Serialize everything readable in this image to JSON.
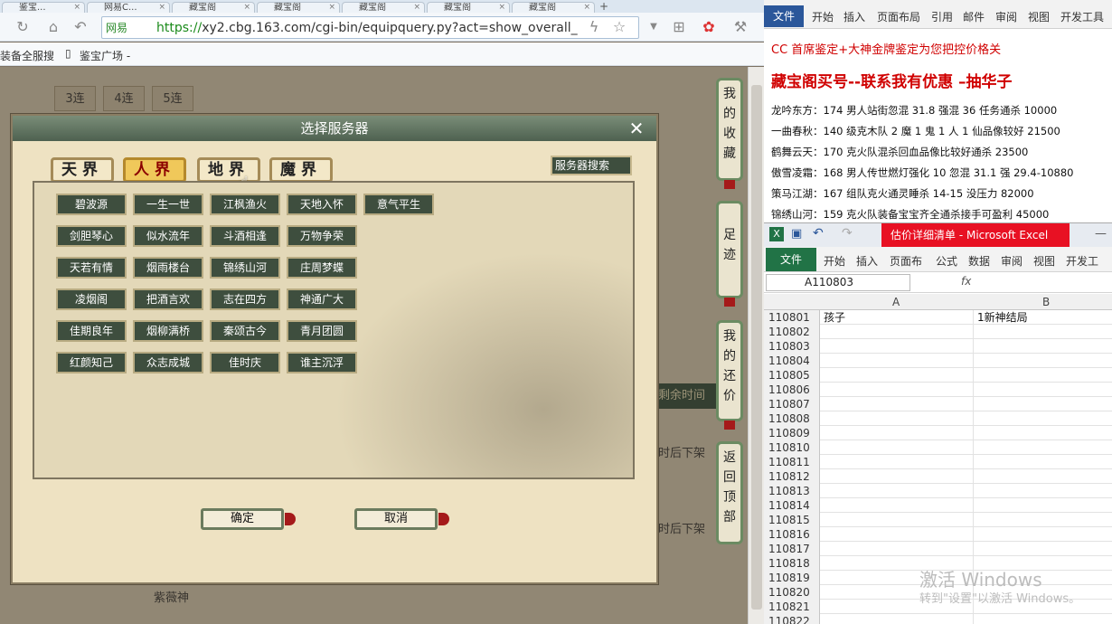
{
  "browser": {
    "tabs": [
      "鉴宝...",
      "网易C...",
      "藏宝阁",
      "藏宝阁",
      "藏宝阁",
      "藏宝阁",
      "藏宝阁"
    ],
    "new_tab": "+",
    "site_label": "网易",
    "url_secure": "https://",
    "url_rest": "xy2.cbg.163.com/cgi-bin/equipquery.py?act=show_overall_",
    "bookmarks": [
      "装备全服搜",
      "鉴宝广场 -"
    ]
  },
  "page": {
    "tabs": [
      "3连",
      "4连",
      "5连"
    ],
    "bg_texts": [
      "剩余时间",
      "时后下架",
      "时后下架",
      "紫薇神"
    ]
  },
  "side_buttons": [
    "我的收藏",
    "足迹",
    "我的还价",
    "返回顶部"
  ],
  "dialog": {
    "title": "选择服务器",
    "close": "✕",
    "realms": [
      "天界",
      "人界",
      "地界",
      "魔界"
    ],
    "active_realm": "人界",
    "search_button": "服务器搜索",
    "servers": [
      [
        "碧波源",
        "一生一世",
        "江枫渔火",
        "天地入怀",
        "意气平生"
      ],
      [
        "剑胆琴心",
        "似水流年",
        "斗酒相逢",
        "万物争荣"
      ],
      [
        "天若有情",
        "烟雨楼台",
        "锦绣山河",
        "庄周梦蝶"
      ],
      [
        "凌烟阁",
        "把酒言欢",
        "志在四方",
        "神通广大"
      ],
      [
        "佳期良年",
        "烟柳满桥",
        "秦颂古今",
        "青月团圆"
      ],
      [
        "红颜知己",
        "众志成城",
        "佳时庆",
        "谁主沉浮"
      ]
    ],
    "ok": "确定",
    "cancel": "取消"
  },
  "word": {
    "ribbon_file": "文件",
    "ribbon_tabs": [
      "开始",
      "插入",
      "页面布局",
      "引用",
      "邮件",
      "审阅",
      "视图",
      "开发工具"
    ],
    "line1": "CC 首席鉴定+大神金牌鉴定为您把控价格关",
    "line2": "藏宝阁买号--联系我有优惠 –抽华子",
    "entries": [
      "龙吟东方：174 男人站街忽混 31.8 强混 36 任务通杀 10000",
      "一曲春秋：140 级克木队 2 魔 1 鬼 1 人 1 仙品像较好 21500",
      "鹤舞云天：170 克火队混杀回血品像比较好通杀 23500",
      "傲雪凌霜：168 男人传世燃灯强化 10 忽混 31.1 强 29.4-10880",
      "策马江湖：167 组队克火通灵睡杀 14-15 没压力 82000",
      "锦绣山河：159 克火队装备宝宝齐全通杀接手可盈利 45000"
    ]
  },
  "excel": {
    "title": "估价详细清单 - Microsoft Excel",
    "ribbon_file": "文件",
    "ribbon_tabs": [
      "开始",
      "插入",
      "页面布",
      "公式",
      "数据",
      "审阅",
      "视图",
      "开发工"
    ],
    "namebox": "A110803",
    "fx": "fx",
    "col_a": "A",
    "col_b": "B",
    "rows": [
      {
        "n": "110801",
        "a": "孩子",
        "b": "1新神结局"
      },
      {
        "n": "110802",
        "a": "",
        "b": ""
      },
      {
        "n": "110803",
        "a": "",
        "b": ""
      },
      {
        "n": "110804",
        "a": "",
        "b": ""
      },
      {
        "n": "110805",
        "a": "",
        "b": ""
      },
      {
        "n": "110806",
        "a": "",
        "b": ""
      },
      {
        "n": "110807",
        "a": "",
        "b": ""
      },
      {
        "n": "110808",
        "a": "",
        "b": ""
      },
      {
        "n": "110809",
        "a": "",
        "b": ""
      },
      {
        "n": "110810",
        "a": "",
        "b": ""
      },
      {
        "n": "110811",
        "a": "",
        "b": ""
      },
      {
        "n": "110812",
        "a": "",
        "b": ""
      },
      {
        "n": "110813",
        "a": "",
        "b": ""
      },
      {
        "n": "110814",
        "a": "",
        "b": ""
      },
      {
        "n": "110815",
        "a": "",
        "b": ""
      },
      {
        "n": "110816",
        "a": "",
        "b": ""
      },
      {
        "n": "110817",
        "a": "",
        "b": ""
      },
      {
        "n": "110818",
        "a": "",
        "b": ""
      },
      {
        "n": "110819",
        "a": "",
        "b": ""
      },
      {
        "n": "110820",
        "a": "",
        "b": ""
      },
      {
        "n": "110821",
        "a": "",
        "b": ""
      },
      {
        "n": "110822",
        "a": "",
        "b": ""
      }
    ],
    "watermark1": "激活 Windows",
    "watermark2": "转到\"设置\"以激活 Windows。"
  }
}
